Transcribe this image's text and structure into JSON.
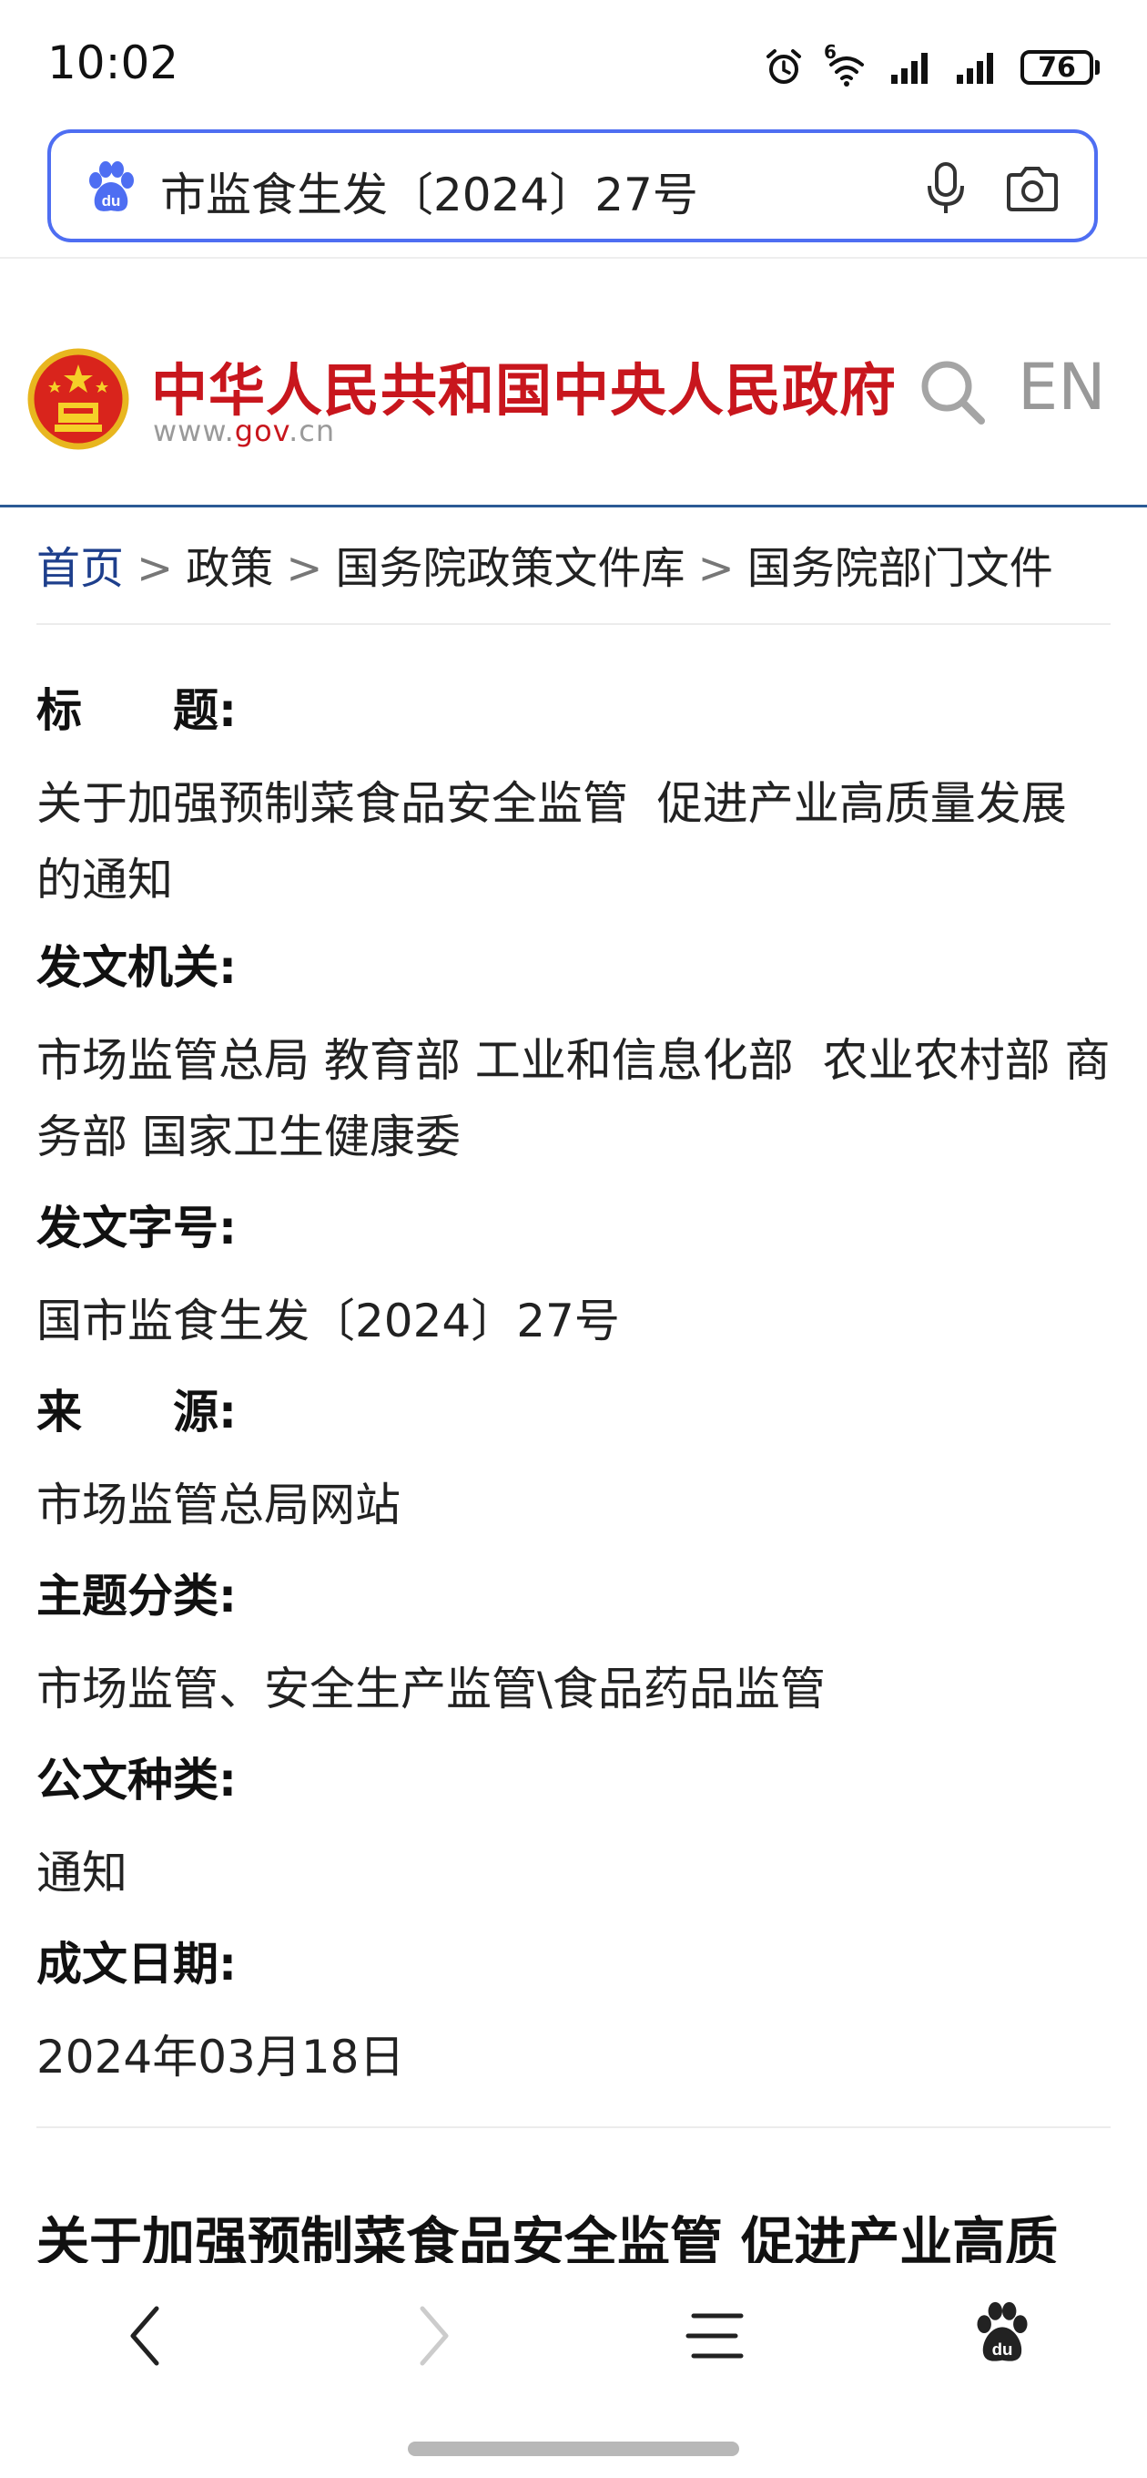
{
  "status_bar": {
    "time": "10:02",
    "battery": "76",
    "network": "6"
  },
  "search": {
    "query": "市监食生发〔2024〕27号",
    "icons": [
      "baidu-paw-icon",
      "microphone-icon",
      "camera-icon"
    ]
  },
  "site": {
    "name": "中华人民共和国中央人民政府",
    "url_prefix": "www.",
    "url_gov": "gov",
    "url_suffix": ".cn",
    "lang_label": "EN",
    "accent_color": "#c8161d"
  },
  "breadcrumb": {
    "items": [
      "首页",
      "政策",
      "国务院政策文件库",
      "国务院部门文件"
    ],
    "separator": ">"
  },
  "fields": [
    {
      "label": "标　　题:",
      "value": "关于加强预制菜食品安全监管  促进产业高质量发展的通知"
    },
    {
      "label": "发文机关:",
      "value": "市场监管总局 教育部 工业和信息化部  农业农村部 商务部 国家卫生健康委"
    },
    {
      "label": "发文字号:",
      "value": "国市监食生发〔2024〕27号"
    },
    {
      "label": "来　　源:",
      "value": "市场监管总局网站"
    },
    {
      "label": "主题分类:",
      "value": "市场监管、安全生产监管\\食品药品监管"
    },
    {
      "label": "公文种类:",
      "value": "通知"
    },
    {
      "label": "成文日期:",
      "value": "2024年03月18日"
    }
  ],
  "article": {
    "title": "关于加强预制菜食品安全监管  促进产业高质"
  },
  "bottom_nav": [
    "back-icon",
    "forward-icon",
    "menu-icon",
    "baidu-home-icon"
  ]
}
